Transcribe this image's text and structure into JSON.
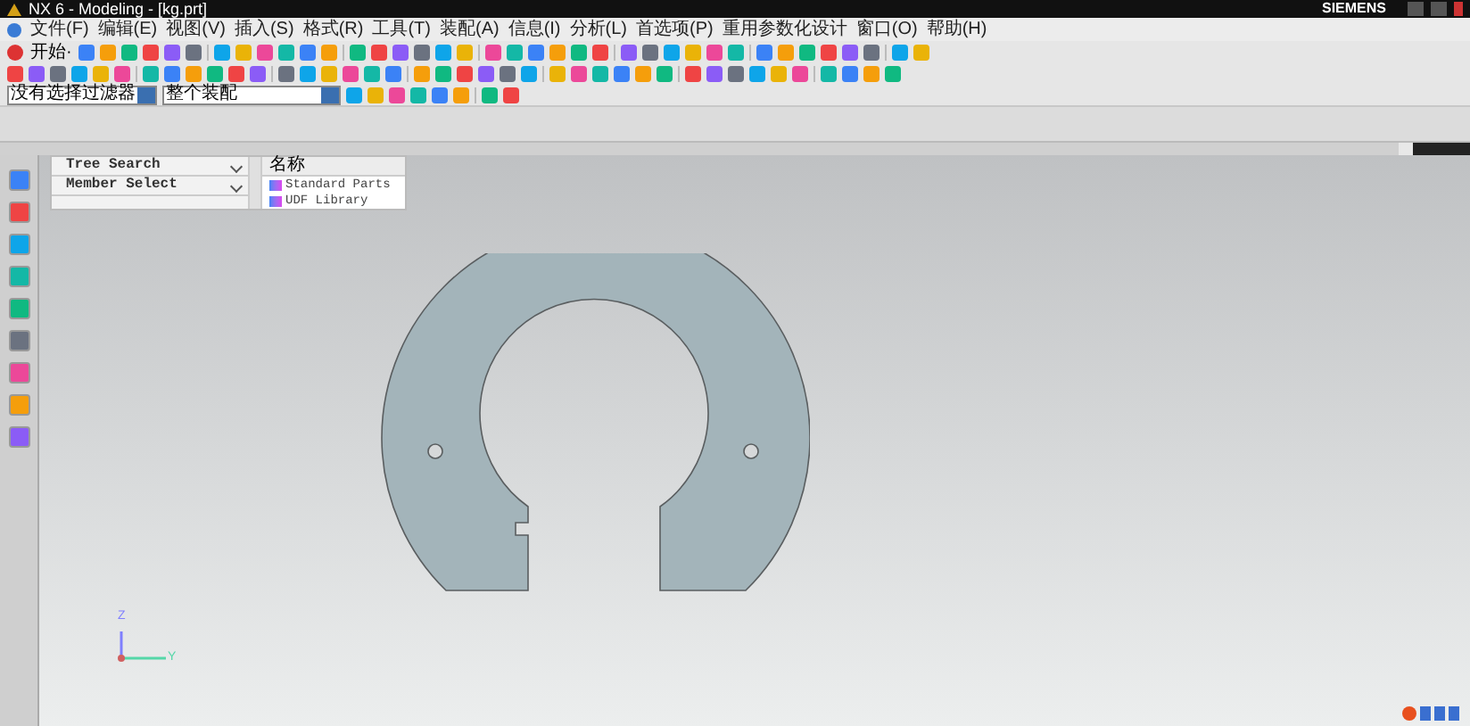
{
  "window": {
    "title": "NX 6 - Modeling - [kg.prt]",
    "brand": "SIEMENS"
  },
  "menu": [
    "文件(F)",
    "编辑(E)",
    "视图(V)",
    "插入(S)",
    "格式(R)",
    "工具(T)",
    "装配(A)",
    "信息(I)",
    "分析(L)",
    "首选项(P)",
    "重用参数化设计",
    "窗口(O)",
    "帮助(H)"
  ],
  "toolbar": {
    "start_label": "开始·"
  },
  "filters": [
    {
      "value": "没有选择过滤器"
    },
    {
      "value": "整个装配"
    }
  ],
  "navigator": {
    "sections": [
      "Tree Search",
      "Member Select"
    ],
    "column": "名称",
    "items": [
      {
        "label": "Standard Parts"
      },
      {
        "label": "UDF Library"
      }
    ]
  },
  "axes": {
    "vertical": "Z",
    "horizontal": "Y"
  }
}
